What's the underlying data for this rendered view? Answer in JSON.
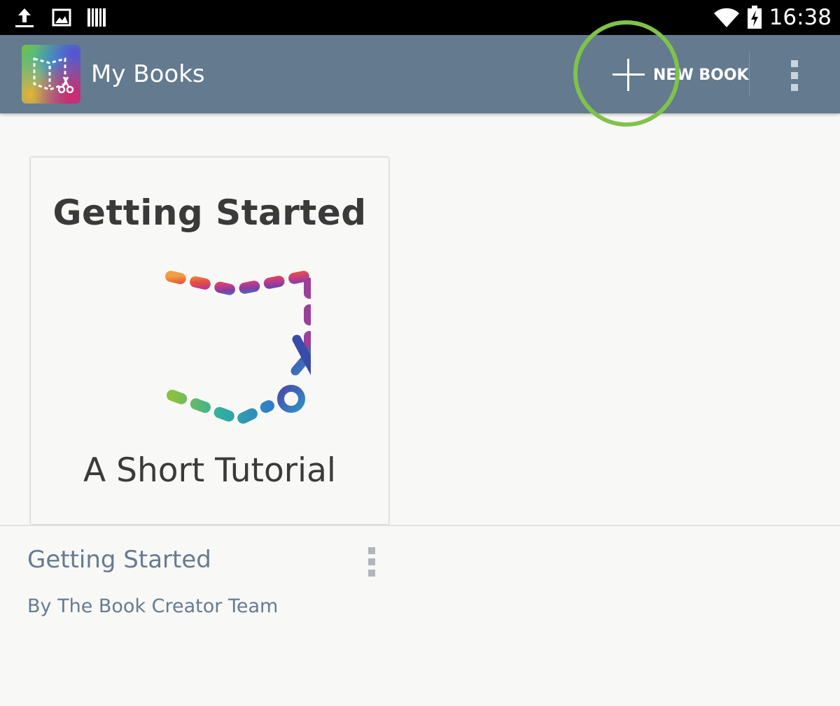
{
  "status_bar": {
    "time": "16:38",
    "icons": [
      "upload-icon",
      "image-icon",
      "barcode-icon",
      "wifi-icon",
      "battery-charging-icon"
    ]
  },
  "app_bar": {
    "title": "My Books",
    "new_book_label": "NEW BOOK",
    "accent": "#637a8f",
    "highlight_color": "#80c24a"
  },
  "books": [
    {
      "cover_title": "Getting Started",
      "cover_subtitle": "A Short Tutorial",
      "name": "Getting Started",
      "author": "By The Book Creator Team"
    }
  ]
}
